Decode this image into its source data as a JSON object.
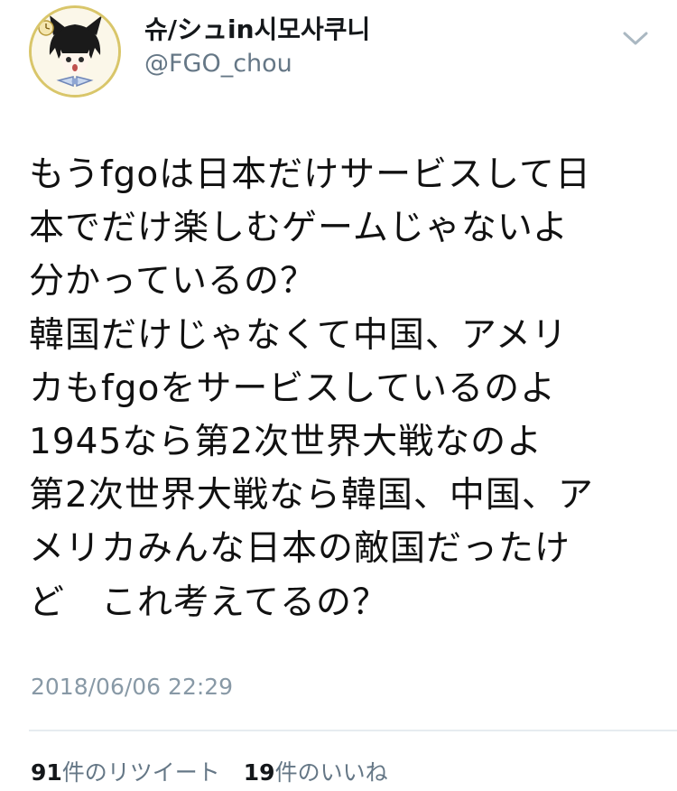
{
  "tweet": {
    "author": {
      "display_name": "슈/シュin시모사쿠니",
      "handle": "@FGO_chou",
      "avatar_icon": "avatar-icon"
    },
    "menu_icon": "chevron-down-icon",
    "body_lines": [
      "もうfgoは日本だけサービスして日",
      "本でだけ楽しむゲームじゃないよ",
      "分かっているの？",
      "韓国だけじゃなくて中国、アメリ",
      "カもfgoをサービスしているのよ",
      "1945なら第2次世界大戦なのよ",
      "第2次世界大戦なら韓国、中国、ア",
      "メリカみんな日本の敵国だったけ",
      "ど　これ考えてるの？"
    ],
    "timestamp": "2018/06/06 22:29",
    "retweets": {
      "count": "91",
      "label": "件のリツイート"
    },
    "likes": {
      "count": "19",
      "label": "件のいいね"
    }
  },
  "colors": {
    "name": "#14171a",
    "secondary": "#657786",
    "timestamp": "#8899a6",
    "divider": "#e6ecf0",
    "avatar_ring": "#d9c66a"
  }
}
